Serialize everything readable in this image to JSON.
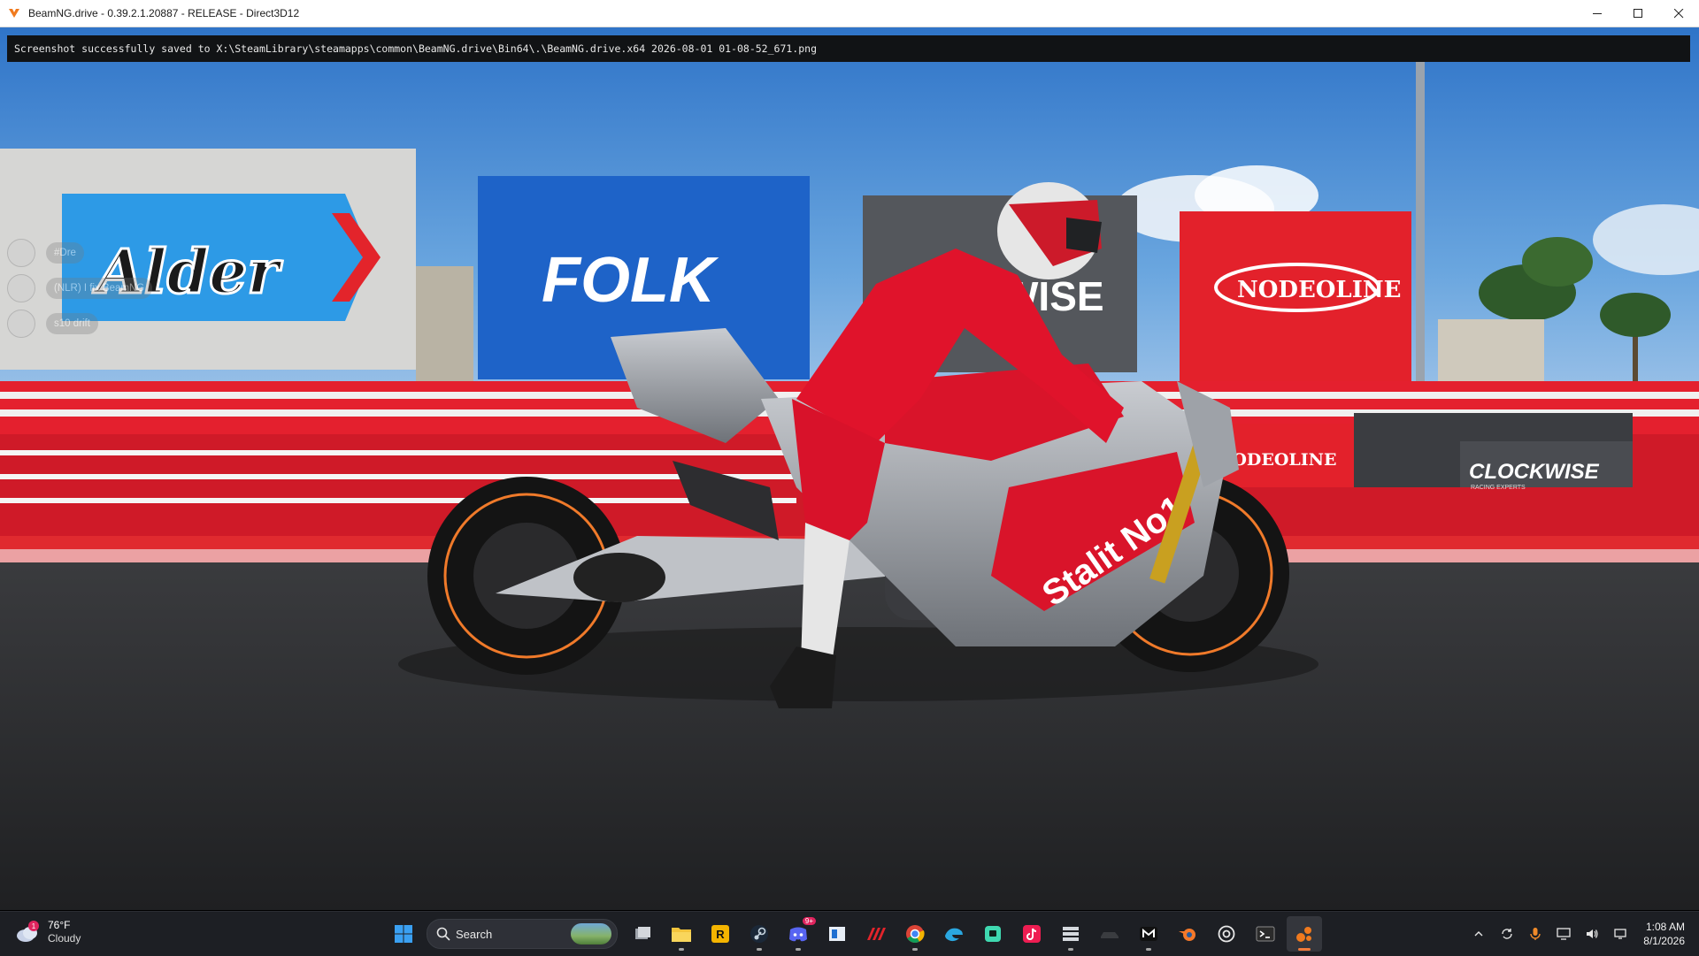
{
  "window": {
    "title": "BeamNG.drive - 0.39.2.1.20887 - RELEASE - Direct3D12",
    "icon": "beamng-icon",
    "controls": [
      "minimize-icon",
      "maximize-icon",
      "close-icon"
    ]
  },
  "game": {
    "console_message": "Screenshot successfully saved to X:\\SteamLibrary\\steamapps\\common\\BeamNG.drive\\Bin64\\.\\BeamNG.drive.x64 2026-08-01 01-08-52_671.png",
    "chat": [
      {
        "text": "#Dre"
      },
      {
        "text": "(NLR) I fix BeamNG"
      },
      {
        "text": "s10 drift"
      }
    ],
    "billboards": {
      "alder": "Alder",
      "folk": "FOLK",
      "nodeoline": "NODEOLINE",
      "nodeoline_small": "NODEOLINE",
      "clockwise": "CLOCKWISE",
      "clockwise_sub": "RACING EXPERTS",
      "wise_partial": "WISE"
    },
    "bike_livery": "Stalit No1",
    "colors": {
      "sky": "#4a8fd6",
      "track": "#2b2c2e",
      "barrier_red": "#e4202e",
      "bike_red": "#d9142a"
    }
  },
  "taskbar": {
    "weather": {
      "temp": "76°F",
      "condition": "Cloudy",
      "badge": "1"
    },
    "search_placeholder": "Search",
    "apps": [
      {
        "name": "start-icon"
      },
      {
        "name": "task-view-icon"
      },
      {
        "name": "file-explorer-icon"
      },
      {
        "name": "rockstar-launcher-icon"
      },
      {
        "name": "steam-icon"
      },
      {
        "name": "discord-icon",
        "badge": "9+"
      },
      {
        "name": "app-window-icon"
      },
      {
        "name": "assetto-corsa-icon"
      },
      {
        "name": "chrome-icon"
      },
      {
        "name": "edge-icon"
      },
      {
        "name": "twitch-icon"
      },
      {
        "name": "tiktok-icon"
      },
      {
        "name": "server-app-icon"
      },
      {
        "name": "car-app-icon"
      },
      {
        "name": "m-app-icon"
      },
      {
        "name": "blender-icon"
      },
      {
        "name": "chatgpt-icon"
      },
      {
        "name": "terminal-icon"
      },
      {
        "name": "beamng-taskbar-icon",
        "active": true
      }
    ],
    "tray": [
      "chevron-up-icon",
      "sync-icon",
      "microphone-icon",
      "display-icon",
      "volume-icon",
      "network-icon"
    ],
    "clock": {
      "time": "1:08 AM",
      "date": "8/1/2026"
    }
  }
}
